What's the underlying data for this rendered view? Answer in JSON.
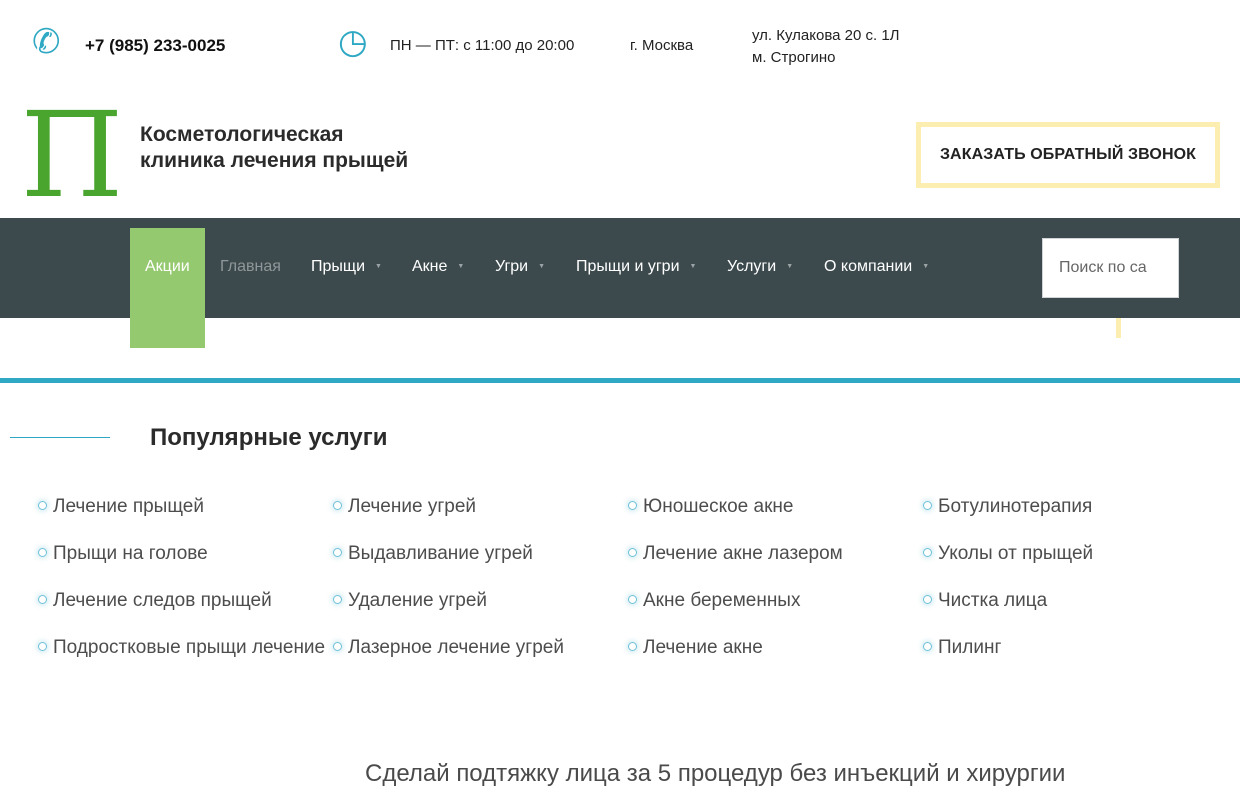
{
  "topbar": {
    "phone_icon": "phone-icon",
    "phone": "+7 (985) 233-0025",
    "clock_icon": "clock-icon",
    "hours": "ПН — ПТ: с 11:00 до 20:00",
    "city": "г. Москва",
    "address_line1": "ул. Кулакова 20 с. 1Л",
    "address_line2": "м. Строгино"
  },
  "header": {
    "logo_letter": "П",
    "brand_line1": "Косметологическая",
    "brand_line2": "клиника лечения прыщей",
    "callback_label": "ЗАКАЗАТЬ ОБРАТНЫЙ ЗВОНОК"
  },
  "nav": {
    "items": [
      {
        "label": "Акции"
      },
      {
        "label": "Главная"
      },
      {
        "label": "Прыщи"
      },
      {
        "label": "Акне"
      },
      {
        "label": "Угри"
      },
      {
        "label": "Прыщи и угри"
      },
      {
        "label": "Услуги"
      },
      {
        "label": "О компании"
      }
    ],
    "search_placeholder": "Поиск по са"
  },
  "popular": {
    "title": "Популярные услуги",
    "columns": [
      [
        "Лечение прыщей",
        "Прыщи на голове",
        "Лечение следов прыщей",
        "Подростковые прыщи лечение"
      ],
      [
        "Лечение угрей",
        "Выдавливание угрей",
        "Удаление угрей",
        "Лазерное лечение угрей"
      ],
      [
        "Юношеское акне",
        "Лечение акне лазером",
        "Акне беременных",
        "Лечение акне"
      ],
      [
        "Ботулинотерапия",
        "Уколы от прыщей",
        "Чистка лица",
        "Пилинг"
      ]
    ]
  },
  "promo": {
    "text": "Сделай подтяжку лица за 5 процедур без инъекций и хирургии"
  },
  "colors": {
    "accent_teal": "#2fa8c3",
    "logo_green": "#4aa52e",
    "nav_bg": "#3d4a4d",
    "nav_active": "#95c96f",
    "button_border": "#fbeeb0"
  }
}
